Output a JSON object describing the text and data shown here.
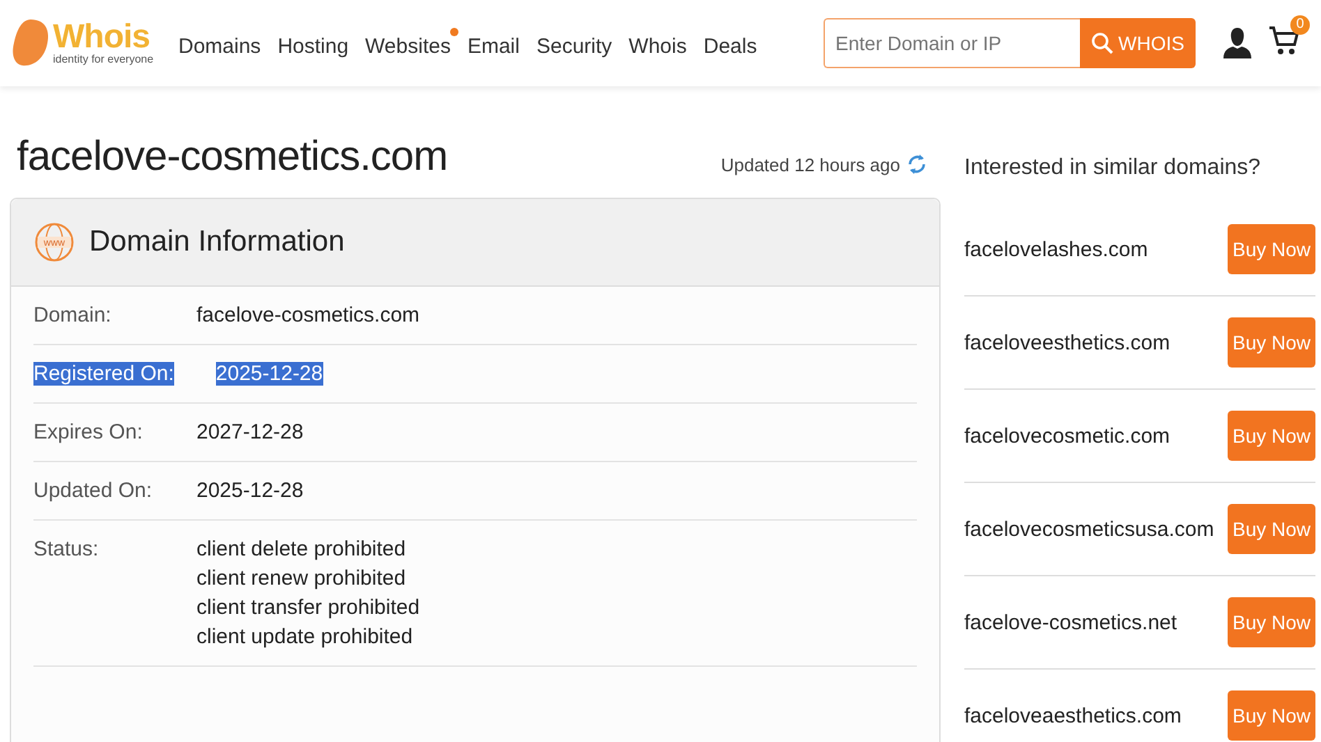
{
  "logo": {
    "name": "Whois",
    "tagline": "identity for everyone"
  },
  "nav": [
    {
      "label": "Domains",
      "dot": false
    },
    {
      "label": "Hosting",
      "dot": false
    },
    {
      "label": "Websites",
      "dot": true
    },
    {
      "label": "Email",
      "dot": false
    },
    {
      "label": "Security",
      "dot": false
    },
    {
      "label": "Whois",
      "dot": false
    },
    {
      "label": "Deals",
      "dot": false
    }
  ],
  "search": {
    "placeholder": "Enter Domain or IP",
    "button": "WHOIS"
  },
  "cart": {
    "count": "0"
  },
  "page_title": "facelove-cosmetics.com",
  "updated": "Updated 12 hours ago",
  "card": {
    "title": "Domain Information",
    "icon_text": "www",
    "rows": [
      {
        "label": "Domain:",
        "values": [
          "facelove-cosmetics.com"
        ],
        "selected": false
      },
      {
        "label": "Registered On:",
        "values": [
          "2025-12-28"
        ],
        "selected": true
      },
      {
        "label": "Expires On:",
        "values": [
          "2027-12-28"
        ],
        "selected": false
      },
      {
        "label": "Updated On:",
        "values": [
          "2025-12-28"
        ],
        "selected": false
      },
      {
        "label": "Status:",
        "values": [
          "client delete prohibited",
          "client renew prohibited",
          "client transfer prohibited",
          "client update prohibited"
        ],
        "selected": false
      }
    ]
  },
  "similar": {
    "title": "Interested in similar domains?",
    "items": [
      {
        "domain": "facelovelashes.com",
        "button": "Buy Now"
      },
      {
        "domain": "faceloveesthetics.com",
        "button": "Buy Now"
      },
      {
        "domain": "facelovecosmetic.com",
        "button": "Buy Now"
      },
      {
        "domain": "facelovecosmeticsusa.com",
        "button": "Buy Now"
      },
      {
        "domain": "facelove-cosmetics.net",
        "button": "Buy Now"
      },
      {
        "domain": "faceloveaesthetics.com",
        "button": "Buy Now"
      }
    ]
  }
}
